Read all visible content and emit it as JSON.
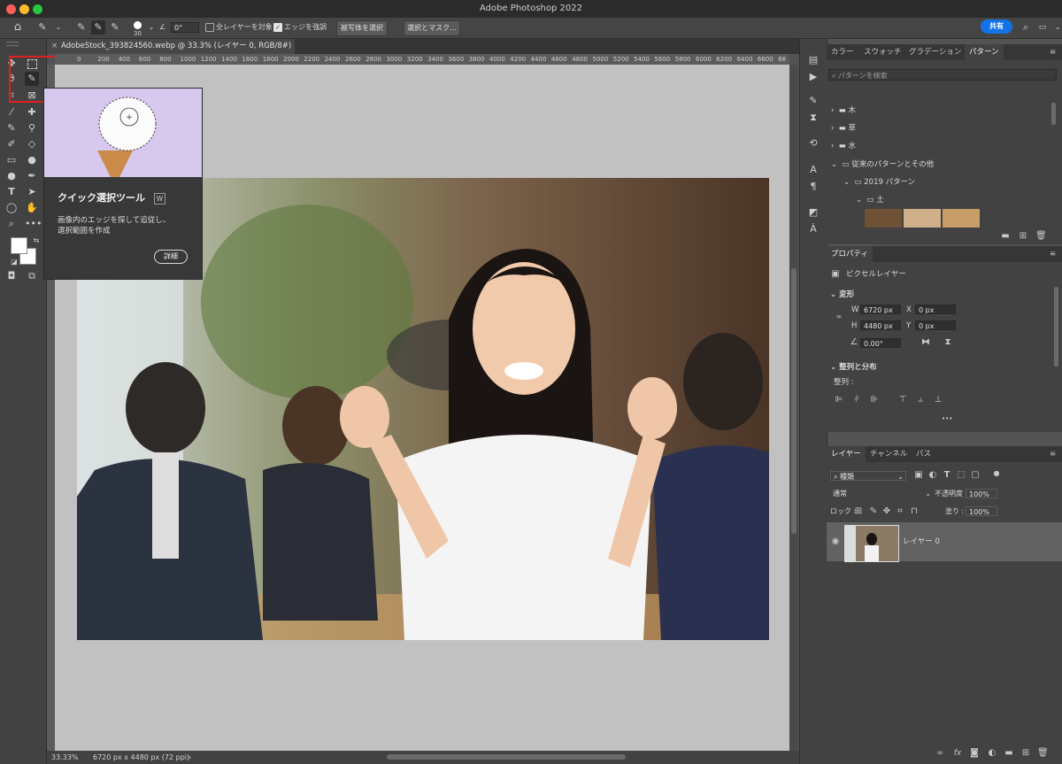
{
  "app": {
    "title": "Adobe Photoshop 2022"
  },
  "options_bar": {
    "brush_size": "30",
    "angle": "0°",
    "sample_all_layers": "全レイヤーを対象",
    "enhance_edge": "エッジを強調",
    "select_subject": "被写体を選択",
    "select_and_mask": "選択とマスク..."
  },
  "share": {
    "label": "共有"
  },
  "document": {
    "tab_title": "AdobeStock_393824560.webp @ 33.3% (レイヤー 0, RGB/8#) *",
    "ruler_ticks": [
      "0",
      "200",
      "400",
      "600",
      "800",
      "1000",
      "1200",
      "1400",
      "1600",
      "1800",
      "2000",
      "2200",
      "2400",
      "2600",
      "2800",
      "3000",
      "3200",
      "3400",
      "3600",
      "3800",
      "4000",
      "4200",
      "4400",
      "4600",
      "4800",
      "5000",
      "5200",
      "5400",
      "5600",
      "5800",
      "6000",
      "6200",
      "6400",
      "6600",
      "68"
    ],
    "zoom": "33.33%",
    "doc_info": "6720 px x 4480 px (72 ppi)"
  },
  "tooltip": {
    "title": "クイック選択ツール",
    "shortcut": "W",
    "description": "画像内のエッジを探して追従し、選択範囲を作成",
    "details_button": "詳細"
  },
  "patterns_panel": {
    "tabs": [
      "カラー",
      "スウォッチ",
      "グラデーション",
      "パターン"
    ],
    "search_placeholder": "パターンを検索",
    "folders": [
      "木",
      "草",
      "水",
      "従来のパターンとその他",
      "2019 パターン",
      "土"
    ]
  },
  "properties_panel": {
    "tab": "プロパティ",
    "layer_type": "ピクセルレイヤー",
    "transform_title": "変形",
    "w_label": "W",
    "w_value": "6720 px",
    "x_label": "X",
    "x_value": "0 px",
    "h_label": "H",
    "h_value": "4480 px",
    "y_label": "Y",
    "y_value": "0 px",
    "angle_value": "0.00°",
    "align_title": "整列と分布",
    "align_label": "整列 :",
    "more": "•••"
  },
  "layers_panel": {
    "tabs": [
      "レイヤー",
      "チャンネル",
      "パス"
    ],
    "filter_kind": "種類",
    "blend_mode": "通常",
    "opacity_label": "不透明度 :",
    "opacity_value": "100%",
    "lock_label": "ロック :",
    "fill_label": "塗り :",
    "fill_value": "100%",
    "layer_name": "レイヤー 0"
  },
  "colors": {
    "accent": "#1473e6",
    "highlight_box": "#e02020"
  }
}
